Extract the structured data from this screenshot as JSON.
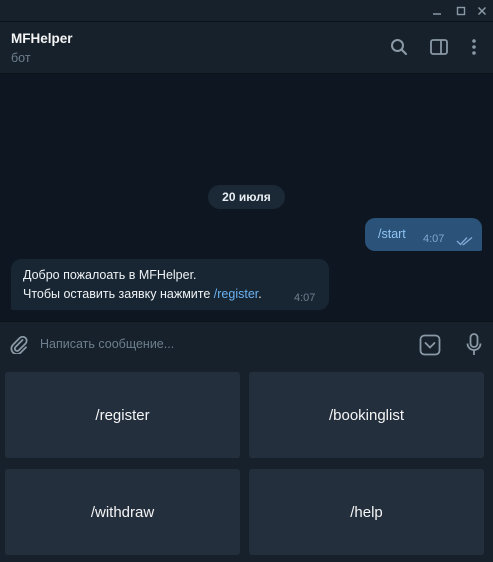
{
  "window": {
    "minimize_icon": "minimize-icon",
    "maximize_icon": "maximize-icon",
    "close_icon": "close-icon"
  },
  "header": {
    "title": "MFHelper",
    "subtitle": "бот",
    "icons": [
      "search-icon",
      "sidebar-toggle-icon",
      "more-vertical-icon"
    ]
  },
  "chat": {
    "date_label": "20 июля",
    "outgoing": {
      "text": "/start",
      "time": "4:07",
      "status_icon": "double-check-icon"
    },
    "incoming": {
      "line1": "Добро пожалоать в MFHelper.",
      "line2_prefix": "Чтобы оставить заявку нажмите ",
      "line2_link": "/register",
      "line2_suffix": ".",
      "time": "4:07"
    }
  },
  "composer": {
    "placeholder": "Написать сообщение...",
    "value": "",
    "icons": [
      "attach-icon",
      "keyboard-toggle-icon",
      "microphone-icon"
    ]
  },
  "keyboard": {
    "buttons": [
      "/register",
      "/bookinglist",
      "/withdraw",
      "/help"
    ]
  },
  "colors": {
    "background": "#0e1621",
    "panel": "#17212b",
    "outgoing_bubble": "#2b5278",
    "incoming_bubble": "#182533",
    "link": "#6ab3f3",
    "keyboard_button": "#242f3d"
  }
}
